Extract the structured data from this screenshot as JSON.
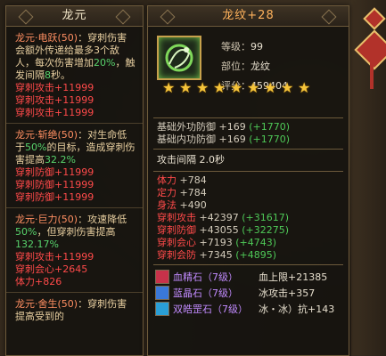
{
  "left_panel": {
    "title": "龙元",
    "skills": [
      {
        "name": "龙元·电跃",
        "level": "(50)",
        "desc_a": "：穿刺伤害会额外传递给最多3个敌人，每次伤害增加",
        "pct1": "20%",
        "desc_b": "，触发间隔",
        "num2": "8",
        "desc_c": "秒。",
        "stats": [
          "穿刺攻击+11999",
          "穿刺攻击+11999",
          "穿刺攻击+11999"
        ]
      },
      {
        "name": "龙元·斩绝",
        "level": "(50)",
        "desc_a": "：对生命低于",
        "pct1": "50%",
        "desc_b": "的目标，造成穿刺伤害提高",
        "pct2": "32.2%",
        "stats": [
          "穿刺防御+11999",
          "穿刺防御+11999",
          "穿刺防御+11999"
        ]
      },
      {
        "name": "龙元·巨力",
        "level": "(50)",
        "desc_a": "：攻速降低",
        "pct1": "50%",
        "desc_b": "，但穿刺伤害提高",
        "pct2": "132.17%",
        "stats": [
          "穿刺攻击+11999",
          "穿刺会心+2645",
          "体力+826"
        ]
      },
      {
        "name": "龙元·舍生",
        "level": "(50)",
        "desc_a": "：穿刺伤害提高",
        "tail": "受到的"
      }
    ]
  },
  "right_panel": {
    "title": "龙纹+28",
    "level_label": "等级：",
    "level_value": "99",
    "slot_label": "部位：",
    "slot_value": "龙纹",
    "score_label": "评分：",
    "score_value": "459404",
    "stars": 9,
    "base_stats": [
      {
        "label": "基础外功防御",
        "value": "+169",
        "bonus": "(+1770)"
      },
      {
        "label": "基础内功防御",
        "value": "+169",
        "bonus": "(+1770)"
      }
    ],
    "attack_interval": "攻击间隔 2.0秒",
    "attrs": [
      {
        "label": "体力",
        "value": "+784",
        "bonus": "",
        "color": "red"
      },
      {
        "label": "定力",
        "value": "+784",
        "bonus": "",
        "color": "red"
      },
      {
        "label": "身法",
        "value": "+490",
        "bonus": "",
        "color": "red"
      },
      {
        "label": "穿刺攻击",
        "value": "+42397",
        "bonus": "(+31617)",
        "color": "red"
      },
      {
        "label": "穿刺防御",
        "value": "+43055",
        "bonus": "(+32275)",
        "color": "red"
      },
      {
        "label": "穿刺会心",
        "value": "+7193",
        "bonus": "(+4743)",
        "color": "red"
      },
      {
        "label": "穿刺会防",
        "value": "+7345",
        "bonus": "(+4895)",
        "color": "red"
      }
    ],
    "gems": [
      {
        "name": "血精石（7级）",
        "attr": "血上限+21385",
        "icon_color": "#c8324a"
      },
      {
        "name": "蓝晶石（7级）",
        "attr": "冰攻击+357",
        "icon_color": "#3a78d8"
      },
      {
        "name": "双皓罡石（7级）",
        "attr": "冰・冰）抗+143",
        "icon_color": "#2a9fd6"
      }
    ]
  },
  "colors": {
    "star": "#f5c43a",
    "red_stat": "#ff4a4a",
    "green_bonus": "#4ec857",
    "gem_purple": "#c28bff",
    "skill_orange": "#ff8f62"
  }
}
